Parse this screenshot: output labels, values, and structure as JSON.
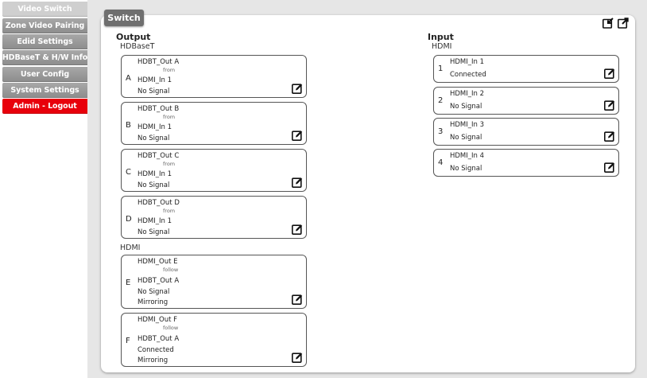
{
  "sidebar": {
    "items": [
      {
        "label": "Video Switch"
      },
      {
        "label": "Zone Video Pairing"
      },
      {
        "label": "Edid Settings"
      },
      {
        "label": "HDBaseT & H/W Info"
      },
      {
        "label": "User Config"
      },
      {
        "label": "System Settings"
      },
      {
        "label": "Admin - Logout"
      }
    ]
  },
  "panel": {
    "tab": "Switch"
  },
  "output": {
    "heading": "Output",
    "hdbaset_label": "HDBaseT",
    "hdmi_label": "HDMI",
    "hdbaset": [
      {
        "letter": "A",
        "name": "HDBT_Out A",
        "rel": "from",
        "source": "HDMI_In 1",
        "status": "No Signal"
      },
      {
        "letter": "B",
        "name": "HDBT_Out B",
        "rel": "from",
        "source": "HDMI_In 1",
        "status": "No Signal"
      },
      {
        "letter": "C",
        "name": "HDBT_Out C",
        "rel": "from",
        "source": "HDMI_In 1",
        "status": "No Signal"
      },
      {
        "letter": "D",
        "name": "HDBT_Out D",
        "rel": "from",
        "source": "HDMI_In 1",
        "status": "No Signal"
      }
    ],
    "hdmi": [
      {
        "letter": "E",
        "name": "HDMI_Out E",
        "rel": "follow",
        "source": "HDBT_Out A",
        "status": "No Signal",
        "mode": "Mirroring"
      },
      {
        "letter": "F",
        "name": "HDMI_Out F",
        "rel": "follow",
        "source": "HDBT_Out A",
        "status": "Connected",
        "mode": "Mirroring"
      }
    ]
  },
  "input": {
    "heading": "Input",
    "hdmi_label": "HDMI",
    "items": [
      {
        "number": "1",
        "name": "HDMI_In 1",
        "status": "Connected"
      },
      {
        "number": "2",
        "name": "HDMI_In 2",
        "status": "No Signal"
      },
      {
        "number": "3",
        "name": "HDMI_In 3",
        "status": "No Signal"
      },
      {
        "number": "4",
        "name": "HDMI_In 4",
        "status": "No Signal"
      }
    ]
  },
  "icons": {
    "edit": "edit-icon",
    "import": "import-icon",
    "export": "export-icon"
  }
}
